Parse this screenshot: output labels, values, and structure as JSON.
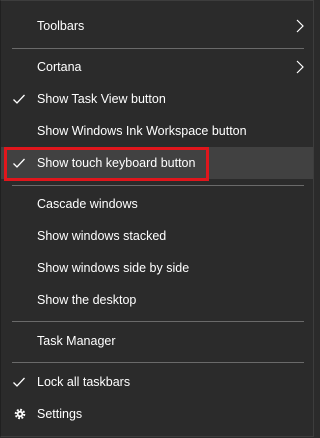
{
  "menu": {
    "items": [
      {
        "label": "Toolbars",
        "submenu": true,
        "checked": false
      },
      {
        "label": "Cortana",
        "submenu": true,
        "checked": false
      },
      {
        "label": "Show Task View button",
        "submenu": false,
        "checked": true
      },
      {
        "label": "Show Windows Ink Workspace button",
        "submenu": false,
        "checked": false
      },
      {
        "label": "Show touch keyboard button",
        "submenu": false,
        "checked": true
      },
      {
        "label": "Cascade windows",
        "submenu": false,
        "checked": false
      },
      {
        "label": "Show windows stacked",
        "submenu": false,
        "checked": false
      },
      {
        "label": "Show windows side by side",
        "submenu": false,
        "checked": false
      },
      {
        "label": "Show the desktop",
        "submenu": false,
        "checked": false
      },
      {
        "label": "Task Manager",
        "submenu": false,
        "checked": false
      },
      {
        "label": "Lock all taskbars",
        "submenu": false,
        "checked": true
      },
      {
        "label": "Settings",
        "submenu": false,
        "checked": false,
        "icon": "gear-icon"
      }
    ]
  },
  "colors": {
    "background": "#2b2b2b",
    "hover": "#414141",
    "highlight_border": "#e0161c",
    "text": "#ffffff",
    "separator": "#6a6a6a"
  }
}
